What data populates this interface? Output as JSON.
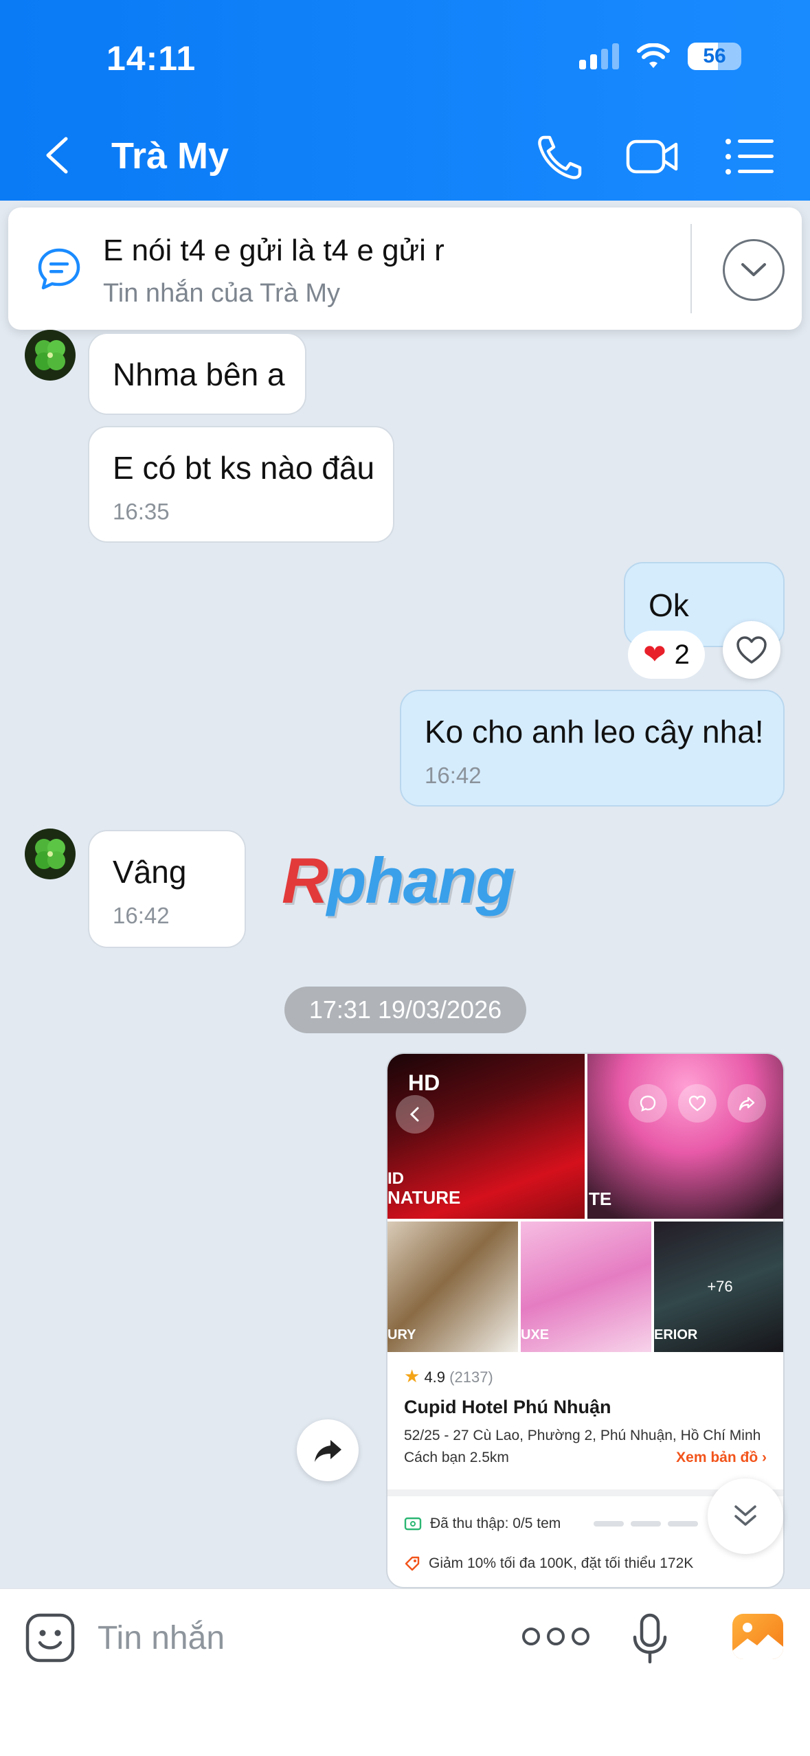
{
  "status_bar": {
    "time": "14:11",
    "battery": "56"
  },
  "header": {
    "title": "Trà My",
    "icons": [
      "back-icon",
      "phone-icon",
      "video-icon",
      "menu-icon"
    ]
  },
  "pinned": {
    "text": "E nói t4 e gửi là t4 e gửi r",
    "subtitle": "Tin nhắn của Trà My"
  },
  "messages": [
    {
      "side": "them",
      "text": "Nhma bên a",
      "time": ""
    },
    {
      "side": "them",
      "text": "E có bt ks nào đâu",
      "time": "16:35"
    },
    {
      "side": "me",
      "text": "Ok",
      "time": "",
      "reaction": "❤",
      "reaction_count": "2"
    },
    {
      "side": "me",
      "text": "Ko cho anh leo cây nha!",
      "time": "16:42"
    },
    {
      "side": "them",
      "text": "Vâng",
      "time": "16:42"
    }
  ],
  "watermark": {
    "first": "R",
    "rest": "phang"
  },
  "date_separator": "17:31 19/03/2026",
  "shared_image": {
    "label_hd": "HD",
    "photo_labels": [
      "ID",
      "NATURE",
      "TE",
      "URY",
      "UXE",
      "ERIOR"
    ],
    "more_photos": "+76",
    "rating": "4.9",
    "rating_count": "(2137)",
    "hotel_name": "Cupid Hotel Phú Nhuận",
    "address": "52/25 - 27 Cù Lao, Phường 2, Phú Nhuận, Hồ Chí Minh",
    "distance": "Cách bạn 2.5km",
    "map_link": "Xem bản đồ",
    "stamps": "Đã thu thập: 0/5 tem",
    "discount": "Giảm 10% tối đa 100K, đặt tối thiểu 172K"
  },
  "input": {
    "placeholder": "Tin nhắn"
  },
  "colors": {
    "header": "#0a7af5",
    "my_bubble": "#d5ecfd",
    "their_bubble": "#ffffff",
    "background": "#e2e9f1",
    "accent_orange": "#f2541b"
  }
}
